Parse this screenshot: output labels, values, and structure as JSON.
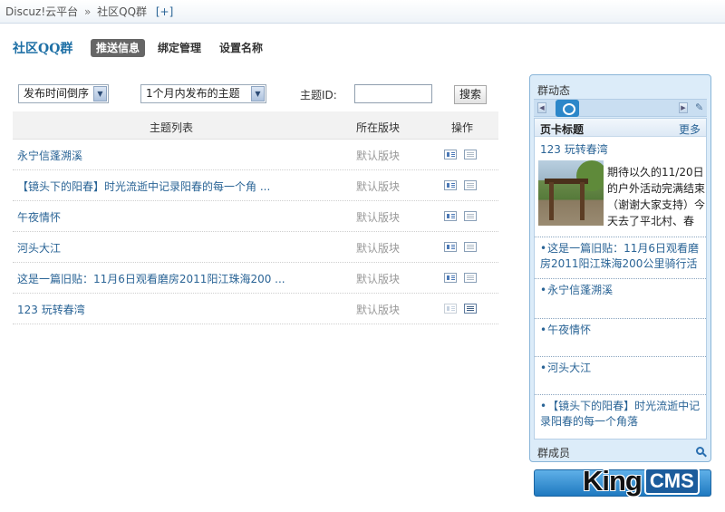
{
  "breadcrumb": {
    "root": "Discuz!云平台",
    "separator": "»",
    "current": "社区QQ群",
    "add_label": "[+]"
  },
  "header": {
    "title": "社区QQ群",
    "tabs": [
      {
        "label": "推送信息",
        "active": true
      },
      {
        "label": "绑定管理",
        "active": false
      },
      {
        "label": "设置名称",
        "active": false
      }
    ]
  },
  "filters": {
    "order_select": "发布时间倒序",
    "time_select": "1个月内发布的主题",
    "topic_id_label": "主题ID:",
    "topic_id_value": "",
    "search_label": "搜索"
  },
  "table": {
    "headers": {
      "topic": "主题列表",
      "board": "所在版块",
      "op": "操作"
    },
    "rows": [
      {
        "title": "永宁信蓬溯溪",
        "board": "默认版块"
      },
      {
        "title": "【镜头下的阳春】时光流逝中记录阳春的每一个角 ...",
        "board": "默认版块"
      },
      {
        "title": "午夜情怀",
        "board": "默认版块"
      },
      {
        "title": "河头大江",
        "board": "默认版块"
      },
      {
        "title": "这是一篇旧贴：11月6日观看磨房2011阳江珠海200 ...",
        "board": "默认版块"
      },
      {
        "title": "123 玩转春湾",
        "board": "默认版块"
      }
    ]
  },
  "widget": {
    "title": "群动态",
    "card_title": "页卡标题",
    "more_label": "更多",
    "featured_link": "123 玩转春湾",
    "featured_text": "期待以久的11/20日的户外活动完满结束（谢谢大家支持）今天去了平北村、春",
    "list": [
      "这是一篇旧贴：11月6日观看磨房2011阳江珠海200公里骑行活",
      "永宁信蓬溯溪",
      "午夜情怀",
      "河头大江",
      "【镜头下的阳春】时光流逝中记录阳春的每一个角落"
    ],
    "footer": "群成员"
  },
  "watermark": {
    "king": "King",
    "cms": "CMS"
  },
  "colors": {
    "link": "#2a6496",
    "title": "#1d6fa5",
    "accent_bar": "#1f79c0"
  }
}
